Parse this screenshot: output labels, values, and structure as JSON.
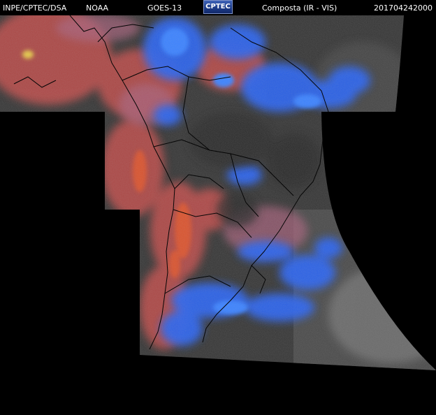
{
  "header": {
    "org": "INPE/CPTEC/DSA",
    "agency": "NOAA",
    "satellite": "GOES-13",
    "logo": "CPTEC",
    "product": "Composta (IR - VIS)",
    "timestamp": "201704242000"
  },
  "colors": {
    "background": "#000000",
    "warm_surface": "#c8504a",
    "cold_cloud": "#2f6cf0",
    "ocean_gray": "#3a3a3a",
    "borders": "#0a0a0a"
  }
}
